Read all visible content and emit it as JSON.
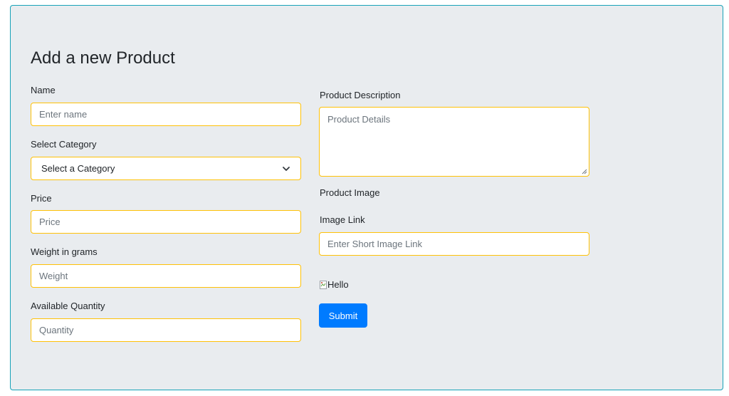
{
  "form": {
    "title": "Add a new Product",
    "name": {
      "label": "Name",
      "placeholder": "Enter name",
      "value": ""
    },
    "category": {
      "label": "Select Category",
      "selected": "Select a Category"
    },
    "price": {
      "label": "Price",
      "placeholder": "Price",
      "value": ""
    },
    "weight": {
      "label": "Weight in grams",
      "placeholder": "Weight",
      "value": ""
    },
    "quantity": {
      "label": "Available Quantity",
      "placeholder": "Quantity",
      "value": ""
    },
    "description": {
      "label": "Product Description",
      "placeholder": "Product Details",
      "value": ""
    },
    "image": {
      "section_label": "Product Image",
      "link_label": "Image Link",
      "link_placeholder": "Enter Short Image Link",
      "preview_alt": "Hello"
    },
    "submit_label": "Submit"
  },
  "colors": {
    "panel_background": "#e9ecef",
    "panel_border": "#17a2b8",
    "field_border": "#ffc107",
    "primary": "#007bff"
  },
  "icons": {
    "select_arrow": "chevron-down-icon",
    "textarea_resize": "resize-grip-icon",
    "broken_image": "broken-image-icon"
  }
}
